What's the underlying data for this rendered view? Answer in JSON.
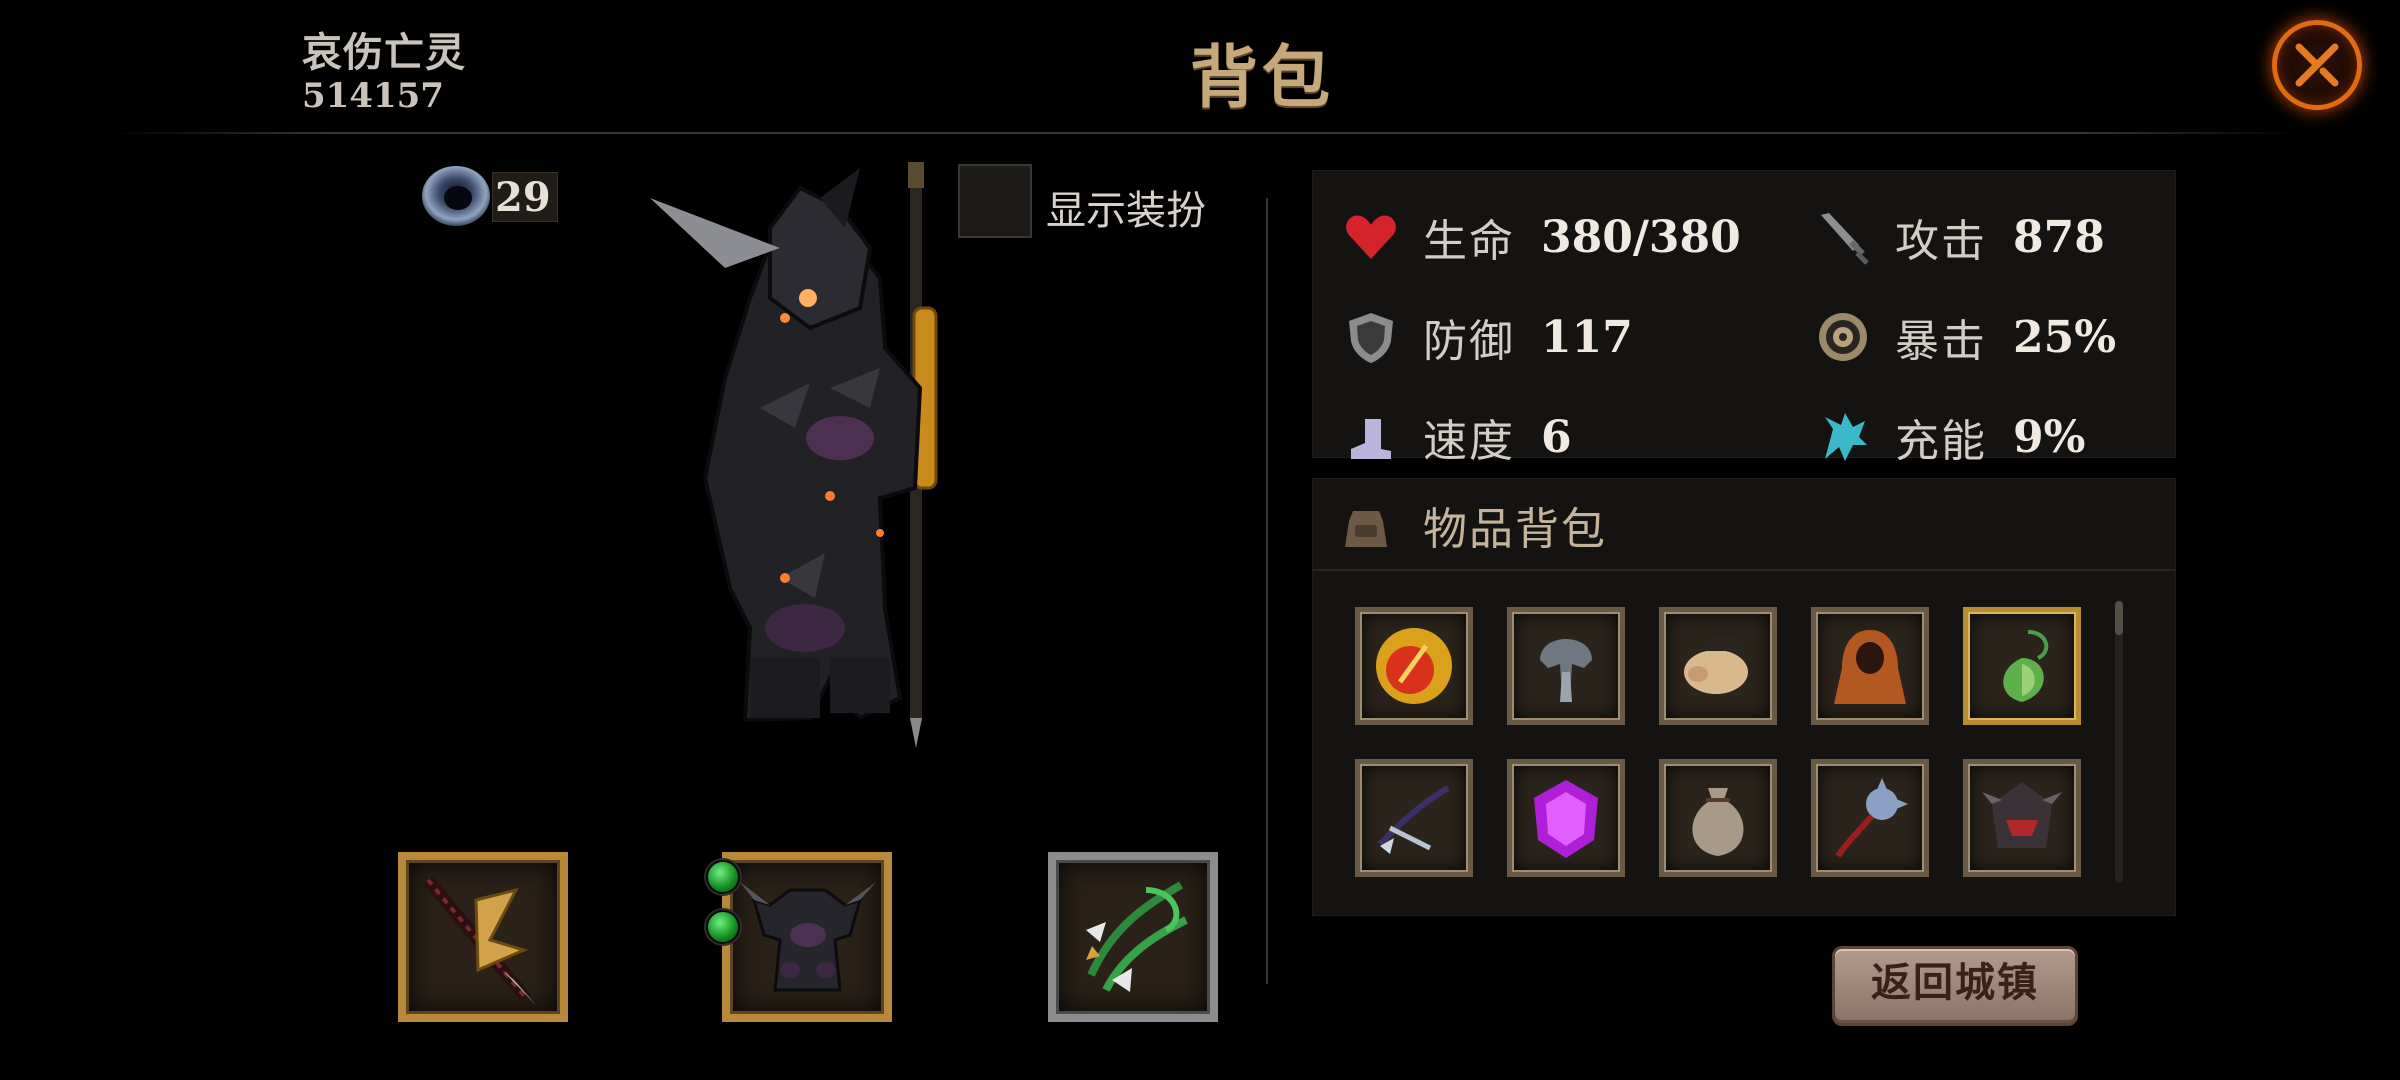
{
  "header": {
    "player_name": "哀伤亡灵",
    "player_id": "514157",
    "title": "背包",
    "close_icon": "close-crossed-circle-icon"
  },
  "character": {
    "portal_stone_count": "29",
    "show_costume_label": "显示装扮",
    "show_costume_checked": false,
    "equipment": [
      {
        "slot": "weapon",
        "icon": "dark-blade-weapon-icon",
        "frame": "gold"
      },
      {
        "slot": "armor",
        "icon": "dark-spiked-armor-icon",
        "frame": "gold",
        "gems": 2
      },
      {
        "slot": "accessory",
        "icon": "green-bow-charm-icon",
        "frame": "silver"
      }
    ]
  },
  "stats": {
    "hp": {
      "label": "生命",
      "value": "380/380",
      "icon": "heart-icon"
    },
    "atk": {
      "label": "攻击",
      "value": "878",
      "icon": "sword-icon"
    },
    "def": {
      "label": "防御",
      "value": "117",
      "icon": "shield-icon"
    },
    "crit": {
      "label": "暴击",
      "value": "25%",
      "icon": "crit-target-icon"
    },
    "speed": {
      "label": "速度",
      "value": "6",
      "icon": "boot-icon"
    },
    "energy": {
      "label": "充能",
      "value": "9%",
      "icon": "energy-claw-icon"
    }
  },
  "inventory": {
    "title": "物品背包",
    "icon": "bag-icon",
    "items": [
      {
        "icon": "fire-orb-icon",
        "frame": "normal"
      },
      {
        "icon": "iron-helmet-icon",
        "frame": "normal"
      },
      {
        "icon": "pig-icon",
        "frame": "normal"
      },
      {
        "icon": "orange-cloak-icon",
        "frame": "normal"
      },
      {
        "icon": "green-amulet-icon",
        "frame": "gold"
      },
      {
        "icon": "crossbow-icon",
        "frame": "normal"
      },
      {
        "icon": "purple-gem-icon",
        "frame": "normal"
      },
      {
        "icon": "sack-icon",
        "frame": "normal"
      },
      {
        "icon": "spiked-flail-icon",
        "frame": "normal"
      },
      {
        "icon": "dark-helm-icon",
        "frame": "normal"
      }
    ]
  },
  "actions": {
    "return_town": "返回城镇"
  },
  "colors": {
    "title_gold": "#c6a87a",
    "frame_gold": "#b8893a",
    "close_orange": "#e06b12"
  }
}
